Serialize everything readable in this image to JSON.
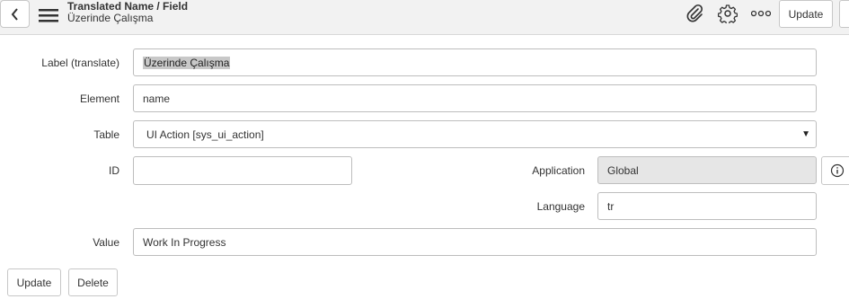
{
  "header": {
    "title": "Translated Name / Field",
    "subtitle": "Üzerinde Çalışma",
    "update_label": "Update",
    "icons": [
      "back-icon",
      "menu-icon",
      "paperclip-icon",
      "gear-icon",
      "more-icon"
    ]
  },
  "form": {
    "label": {
      "label": "Label (translate)",
      "value": "Üzerinde Çalışma"
    },
    "element": {
      "label": "Element",
      "value": "name"
    },
    "table": {
      "label": "Table",
      "value": "UI Action [sys_ui_action]"
    },
    "id": {
      "label": "ID",
      "value": ""
    },
    "application": {
      "label": "Application",
      "value": "Global"
    },
    "language": {
      "label": "Language",
      "value": "tr"
    },
    "value": {
      "label": "Value",
      "value": "Work In Progress"
    }
  },
  "actions": {
    "update_label": "Update",
    "delete_label": "Delete"
  }
}
